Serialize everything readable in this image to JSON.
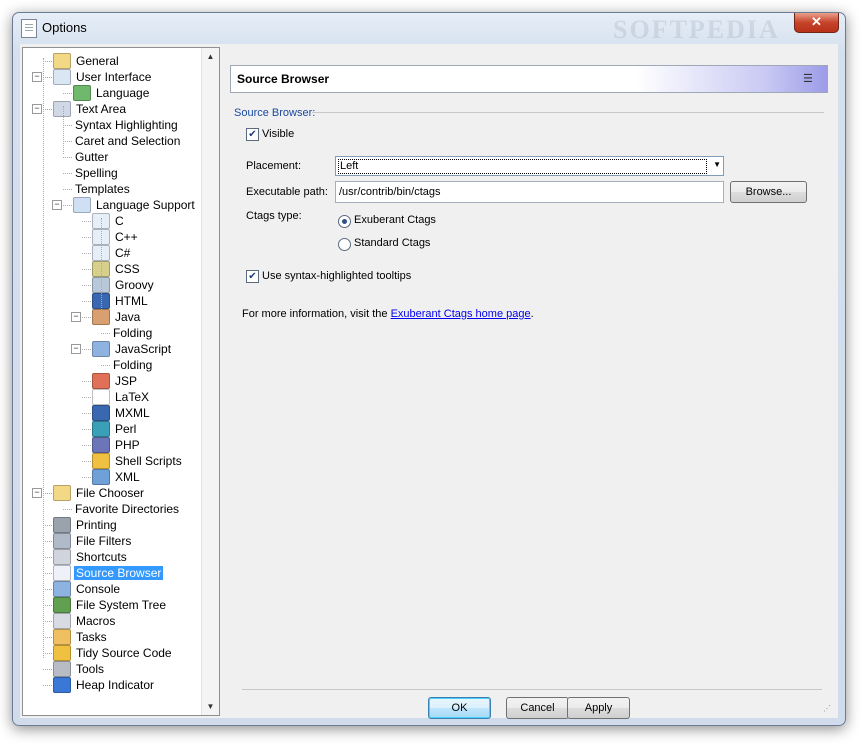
{
  "window": {
    "title": "Options",
    "close_label": "✕",
    "watermark": "SOFTPEDIA"
  },
  "tree": {
    "items": [
      {
        "label": "General",
        "icon": "general-icon",
        "color": "#f3d886"
      },
      {
        "label": "User Interface",
        "icon": "window-icon",
        "color": "#dbe6f4"
      },
      {
        "label": "Language",
        "icon": "globe-icon",
        "color": "#6fb86c"
      },
      {
        "label": "Text Area",
        "icon": "text-area-icon",
        "color": "#d0d8e8"
      },
      {
        "label": "Syntax Highlighting",
        "icon": "",
        "color": ""
      },
      {
        "label": "Caret and Selection",
        "icon": "",
        "color": ""
      },
      {
        "label": "Gutter",
        "icon": "",
        "color": ""
      },
      {
        "label": "Spelling",
        "icon": "",
        "color": ""
      },
      {
        "label": "Templates",
        "icon": "",
        "color": ""
      },
      {
        "label": "Language Support",
        "icon": "speech-bubble-icon",
        "color": "#cfe0f4"
      },
      {
        "label": "C",
        "icon": "c-file-icon",
        "color": "#e6eef8"
      },
      {
        "label": "C++",
        "icon": "cpp-file-icon",
        "color": "#e6eef8"
      },
      {
        "label": "C#",
        "icon": "csharp-file-icon",
        "color": "#e6eef8"
      },
      {
        "label": "CSS",
        "icon": "css-icon",
        "color": "#d6d08c"
      },
      {
        "label": "Groovy",
        "icon": "groovy-star-icon",
        "color": "#b8c8d8"
      },
      {
        "label": "HTML",
        "icon": "html-icon",
        "color": "#3a68b0"
      },
      {
        "label": "Java",
        "icon": "java-cup-icon",
        "color": "#d8a070"
      },
      {
        "label": "Folding",
        "icon": "",
        "color": ""
      },
      {
        "label": "JavaScript",
        "icon": "javascript-icon",
        "color": "#8fb3e0"
      },
      {
        "label": "Folding",
        "icon": "",
        "color": ""
      },
      {
        "label": "JSP",
        "icon": "jsp-icon",
        "color": "#e07058"
      },
      {
        "label": "LaTeX",
        "icon": "latex-icon",
        "color": "#ffffff"
      },
      {
        "label": "MXML",
        "icon": "mxml-icon",
        "color": "#3a68b0"
      },
      {
        "label": "Perl",
        "icon": "camel-icon",
        "color": "#3aa0b8"
      },
      {
        "label": "PHP",
        "icon": "php-icon",
        "color": "#6b75b8"
      },
      {
        "label": "Shell Scripts",
        "icon": "penguin-icon",
        "color": "#f0c040"
      },
      {
        "label": "XML",
        "icon": "xml-icon",
        "color": "#6fa0d8"
      },
      {
        "label": "File Chooser",
        "icon": "folder-icon",
        "color": "#f3d886"
      },
      {
        "label": "Favorite Directories",
        "icon": "",
        "color": ""
      },
      {
        "label": "Printing",
        "icon": "printer-icon",
        "color": "#9aa2ac"
      },
      {
        "label": "File Filters",
        "icon": "filter-icon",
        "color": "#b0bac8"
      },
      {
        "label": "Shortcuts",
        "icon": "keyboard-icon",
        "color": "#d0d4dc"
      },
      {
        "label": "Source Browser",
        "icon": "list-icon",
        "color": "#eef2f8"
      },
      {
        "label": "Console",
        "icon": "monitor-icon",
        "color": "#8fb3e0"
      },
      {
        "label": "File System Tree",
        "icon": "tree-icon",
        "color": "#60a050"
      },
      {
        "label": "Macros",
        "icon": "macro-icon",
        "color": "#d8dce2"
      },
      {
        "label": "Tasks",
        "icon": "pencil-icon",
        "color": "#f0c060"
      },
      {
        "label": "Tidy Source Code",
        "icon": "lightning-icon",
        "color": "#f0c040"
      },
      {
        "label": "Tools",
        "icon": "wrench-icon",
        "color": "#b8bcc4"
      },
      {
        "label": "Heap Indicator",
        "icon": "heap-icon",
        "color": "#3a78d8"
      }
    ],
    "selected": "Source Browser"
  },
  "panel": {
    "header_title": "Source Browser",
    "group_label": "Source Browser:",
    "visible_label": "Visible",
    "visible_checked": true,
    "placement_label": "Placement:",
    "placement_value": "Left",
    "exec_label": "Executable path:",
    "exec_value": "/usr/contrib/bin/ctags",
    "browse_label": "Browse...",
    "ctags_label": "Ctags type:",
    "radio_exuberant": "Exuberant Ctags",
    "radio_standard": "Standard Ctags",
    "ctags_selected": "Exuberant Ctags",
    "tooltips_label": "Use syntax-highlighted tooltips",
    "tooltips_checked": true,
    "info_prefix": "For more information, visit the ",
    "info_link": "Exuberant Ctags home page",
    "info_suffix": "."
  },
  "buttons": {
    "ok": "OK",
    "cancel": "Cancel",
    "apply": "Apply"
  },
  "colors": {
    "selection": "#3399ff",
    "link": "#0000ee",
    "group_label": "#1a4aa0",
    "header_gradient_end": "#9c9ce8"
  }
}
